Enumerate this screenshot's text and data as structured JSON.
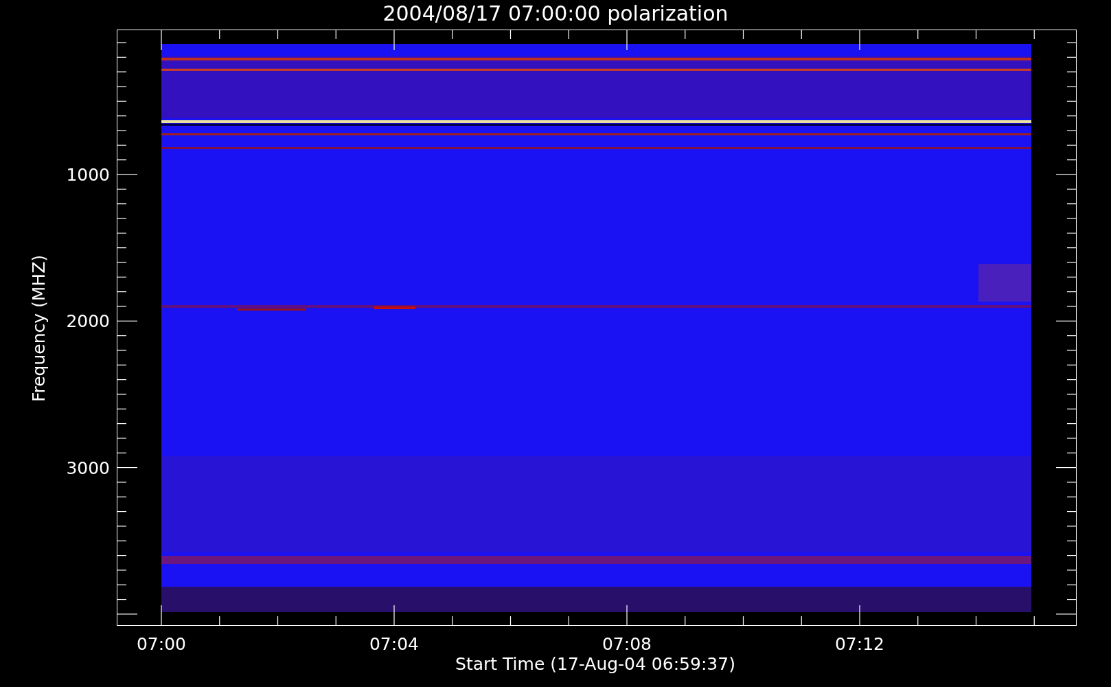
{
  "title": "2004/08/17 07:00:00 polarization",
  "x_axis": {
    "label": "Start Time (17-Aug-04 06:59:37)",
    "ticks": [
      "07:00",
      "07:04",
      "07:08",
      "07:12"
    ]
  },
  "y_axis": {
    "label": "Frequency (MHZ)",
    "ticks": [
      "1000",
      "2000",
      "3000"
    ]
  }
}
